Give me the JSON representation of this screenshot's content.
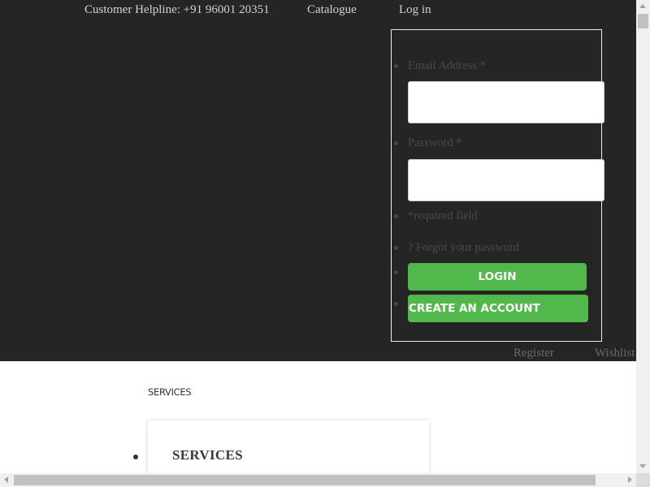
{
  "topbar": {
    "helpline": "Customer Helpline: +91 96001 20351",
    "catalogue": "Catalogue",
    "login": "Log in"
  },
  "login_form": {
    "email_label": "Email Address *",
    "email_value": "",
    "password_label": "Password *",
    "password_value": "",
    "required_note": "*required field",
    "forgot_password": "? Forgot your password",
    "login_button": "LOGIN",
    "create_account_button": "CREATE AN ACCOUNT"
  },
  "account_links": {
    "register": "Register",
    "wishlist": "Wishlist"
  },
  "services": {
    "small_label": "SERVICES",
    "heading": "SERVICES"
  },
  "colors": {
    "header_bg": "#252525",
    "button_green": "#51b94b"
  }
}
